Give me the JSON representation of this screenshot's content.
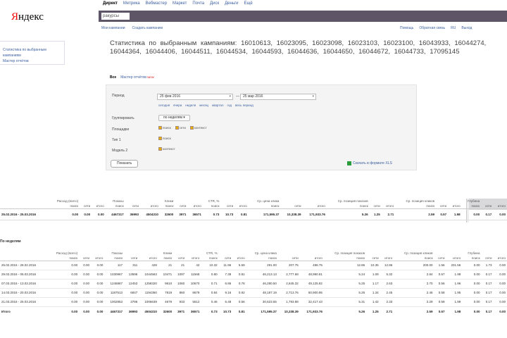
{
  "logo": {
    "first_letter": "Я",
    "rest": "ндекс"
  },
  "topnav": [
    "Директ",
    "Метрика",
    "Вебмастер",
    "Маркет",
    "Почта",
    "Диск",
    "Деньги",
    "Ещё"
  ],
  "search": {
    "value": "ракурсы"
  },
  "sublinks": [
    "Мои кампании",
    "Создать кампанию"
  ],
  "rightlinks": [
    "Помощь",
    "Обратная связь",
    "RU",
    "Выход"
  ],
  "sidebox": {
    "line1": "Статистика по выбранным кампаниям",
    "line2": "Мастер отчётов"
  },
  "heading": "Статистика по выбранным кампаниям: 16010613, 16023095, 16023098, 16023103, 16023100, 16043933, 16044274, 16044364, 16044406, 16044511, 16044534, 16044593, 16044636, 16044650, 16044672, 16044733, 17095145",
  "tabs": {
    "selected": "Все",
    "other": "Мастер отчётов",
    "badge": "NEW"
  },
  "filters": {
    "period_label": "Период",
    "date_from": "25 фев 2016",
    "date_to": "25 мар 2016",
    "quicklinks": [
      "сегодня",
      "вчера",
      "неделя",
      "месяц",
      "квартал",
      "год",
      "весь период"
    ],
    "group_label": "Группировать",
    "group_value": "по неделям",
    "place_label": "Площадки",
    "place_options": [
      "поиск",
      "сети",
      "контекст"
    ],
    "type_label": "Тип 1",
    "type_options": [
      "поиск"
    ],
    "type2_label": "Модель 2",
    "type2_options": [
      "контекст"
    ],
    "show_button": "Показать",
    "export_link": "Скачать в формате XLS"
  },
  "table1": {
    "header1": [
      "",
      "Расход (всего)",
      "",
      "",
      "Показы",
      "",
      "",
      "Клики",
      "",
      "",
      "CTR, %",
      "",
      "",
      "Ср. цена клика",
      "",
      "",
      "Ср. позиция показов",
      "",
      "",
      "Ср. позиция кликов",
      "",
      "",
      "Глубина",
      "",
      ""
    ],
    "header2": [
      "",
      "поиск",
      "сети",
      "итого",
      "поиск",
      "сети",
      "итого",
      "поиск",
      "сети",
      "итого",
      "поиск",
      "сети",
      "итого",
      "поиск",
      "сети",
      "итого",
      "поиск",
      "сети",
      "итого",
      "поиск",
      "сети",
      "итого",
      "поиск",
      "сети",
      "итого"
    ],
    "row": [
      "25.02.2016 - 25.03.2016",
      "0.00",
      "0.00",
      "0.00",
      "4467317",
      "36993",
      "4504310",
      "32600",
      "3971",
      "36571",
      "0.73",
      "10.73",
      "0.81",
      "171,595.37",
      "10,338.39",
      "171,933.76",
      "5.26",
      "1.25",
      "2.71",
      "2.59",
      "0.57",
      "1.98",
      "0.00",
      "0.17",
      "0.00"
    ]
  },
  "section2_title": "По неделям",
  "table2": {
    "header1": [
      "",
      "Расход (всего)",
      "",
      "",
      "Показы",
      "",
      "",
      "Клики",
      "",
      "",
      "CTR, %",
      "",
      "",
      "Ср. цена клика",
      "",
      "",
      "Ср. позиция показов",
      "",
      "",
      "Ср. позиция кликов",
      "",
      "",
      "Глубина",
      "",
      ""
    ],
    "header2": [
      "",
      "поиск",
      "сети",
      "итого",
      "поиск",
      "сети",
      "итого",
      "поиск",
      "сети",
      "итого",
      "поиск",
      "сети",
      "итого",
      "поиск",
      "сети",
      "итого",
      "поиск",
      "сети",
      "итого",
      "поиск",
      "сети",
      "итого",
      "поиск",
      "сети",
      "итого"
    ],
    "rows": [
      [
        "25.02.2016 - 28.02.2016",
        "0.00",
        "0.00",
        "0.00",
        "117",
        "311",
        "428",
        "21",
        "21",
        "42",
        "10.32",
        "11.96",
        "5.59",
        "291.00",
        "207.75",
        "498.75",
        "12.86",
        "10.35",
        "12.86",
        "200.00",
        "1.56",
        "201.56",
        "0.00",
        "1.73",
        "0.00"
      ],
      [
        "29.02.2016 - 06.03.2016",
        "0.00",
        "0.00",
        "0.00",
        "1030967",
        "13596",
        "1044563",
        "10471",
        "1097",
        "11568",
        "0.80",
        "7.38",
        "0.81",
        "46,213.13",
        "2,777.68",
        "48,990.81",
        "5.24",
        "1.09",
        "5.32",
        "2.84",
        "0.57",
        "1.98",
        "0.00",
        "0.17",
        "0.00"
      ],
      [
        "07.03.2016 - 13.03.2016",
        "0.00",
        "0.00",
        "0.00",
        "1245867",
        "12453",
        "1258320",
        "9610",
        "1060",
        "10670",
        "0.71",
        "6.86",
        "0.78",
        "46,280.50",
        "2,845.32",
        "49,125.82",
        "5.25",
        "1.17",
        "2.63",
        "2.70",
        "0.56",
        "1.96",
        "0.00",
        "0.17",
        "0.00"
      ],
      [
        "14.03.2016 - 20.03.2016",
        "0.00",
        "0.00",
        "0.00",
        "1187513",
        "6847",
        "1194360",
        "7819",
        "860",
        "8679",
        "0.84",
        "9.16",
        "0.92",
        "48,187.19",
        "2,713.76",
        "50,900.95",
        "5.26",
        "1.34",
        "2.45",
        "2.46",
        "0.58",
        "1.95",
        "0.00",
        "0.17",
        "0.00"
      ],
      [
        "21.03.2016 - 25.03.2016",
        "0.00",
        "0.00",
        "0.00",
        "1002853",
        "3786",
        "1006639",
        "4679",
        "933",
        "5612",
        "0.46",
        "6.48",
        "0.56",
        "30,623.55",
        "1,793.88",
        "32,417.43",
        "5.31",
        "1.42",
        "2.33",
        "2.29",
        "0.59",
        "1.99",
        "0.00",
        "0.17",
        "0.00"
      ]
    ],
    "total": [
      "Итого",
      "0.00",
      "0.00",
      "0.00",
      "4467317",
      "36993",
      "4504310",
      "32600",
      "3971",
      "36571",
      "0.73",
      "10.73",
      "0.81",
      "171,595.37",
      "10,338.39",
      "171,933.76",
      "5.26",
      "1.25",
      "2.71",
      "2.59",
      "0.57",
      "1.98",
      "0.00",
      "0.17",
      "0.00"
    ]
  }
}
